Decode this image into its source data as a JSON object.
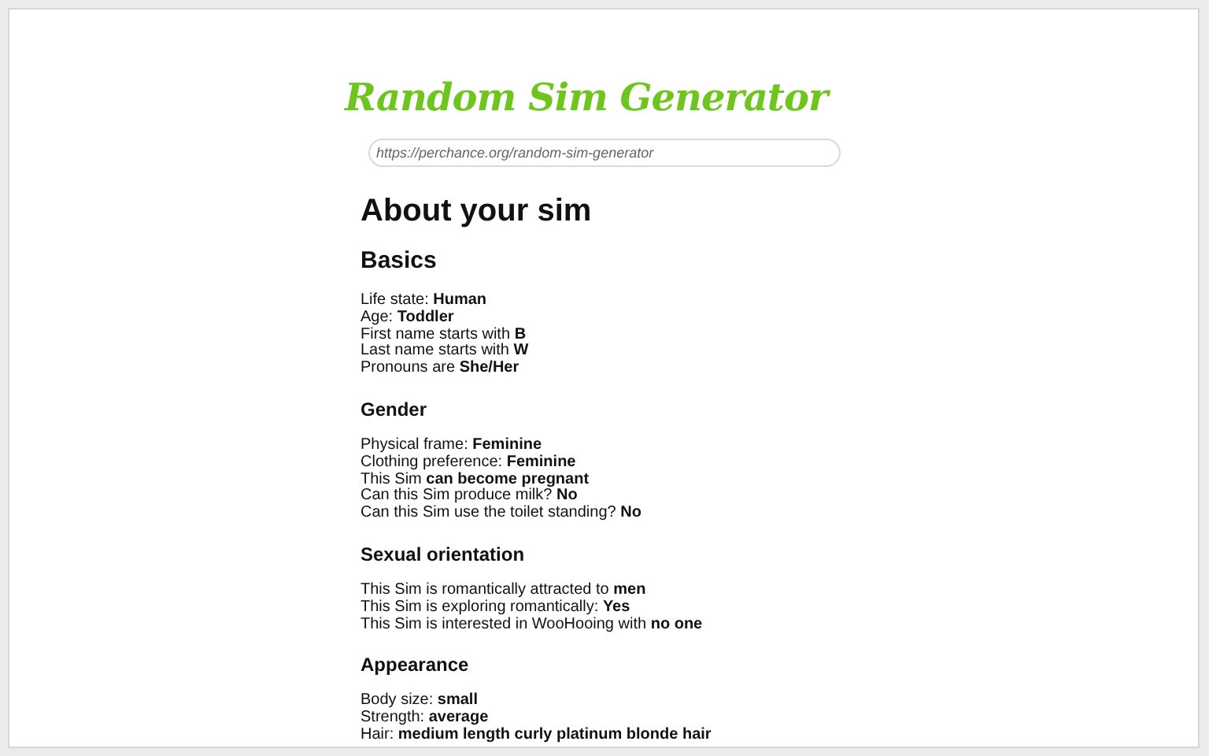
{
  "title": "Random Sim Generator",
  "url_field": {
    "value": "https://perchance.org/random-sim-generator"
  },
  "heading": "About your sim",
  "sections": [
    {
      "title": "Basics",
      "major": true,
      "lines": [
        "Life state: **Human**",
        "Age: **Toddler**",
        "First name starts with **B**",
        "Last name starts with **W**",
        "Pronouns are **She/Her**"
      ]
    },
    {
      "title": "Gender",
      "major": false,
      "lines": [
        "Physical frame: **Feminine**",
        "Clothing preference: **Feminine**",
        "This Sim **can become pregnant**",
        "Can this Sim produce milk? **No**",
        "Can this Sim use the toilet standing? **No**"
      ]
    },
    {
      "title": "Sexual orientation",
      "major": false,
      "lines": [
        "This Sim is romantically attracted to **men**",
        "This Sim is exploring romantically: **Yes**",
        "This Sim is interested in WooHooing with **no one**"
      ]
    },
    {
      "title": "Appearance",
      "major": false,
      "lines": [
        "Body size: **small**",
        "Strength: **average**",
        "Hair: **medium length curly platinum blonde hair**"
      ]
    }
  ]
}
